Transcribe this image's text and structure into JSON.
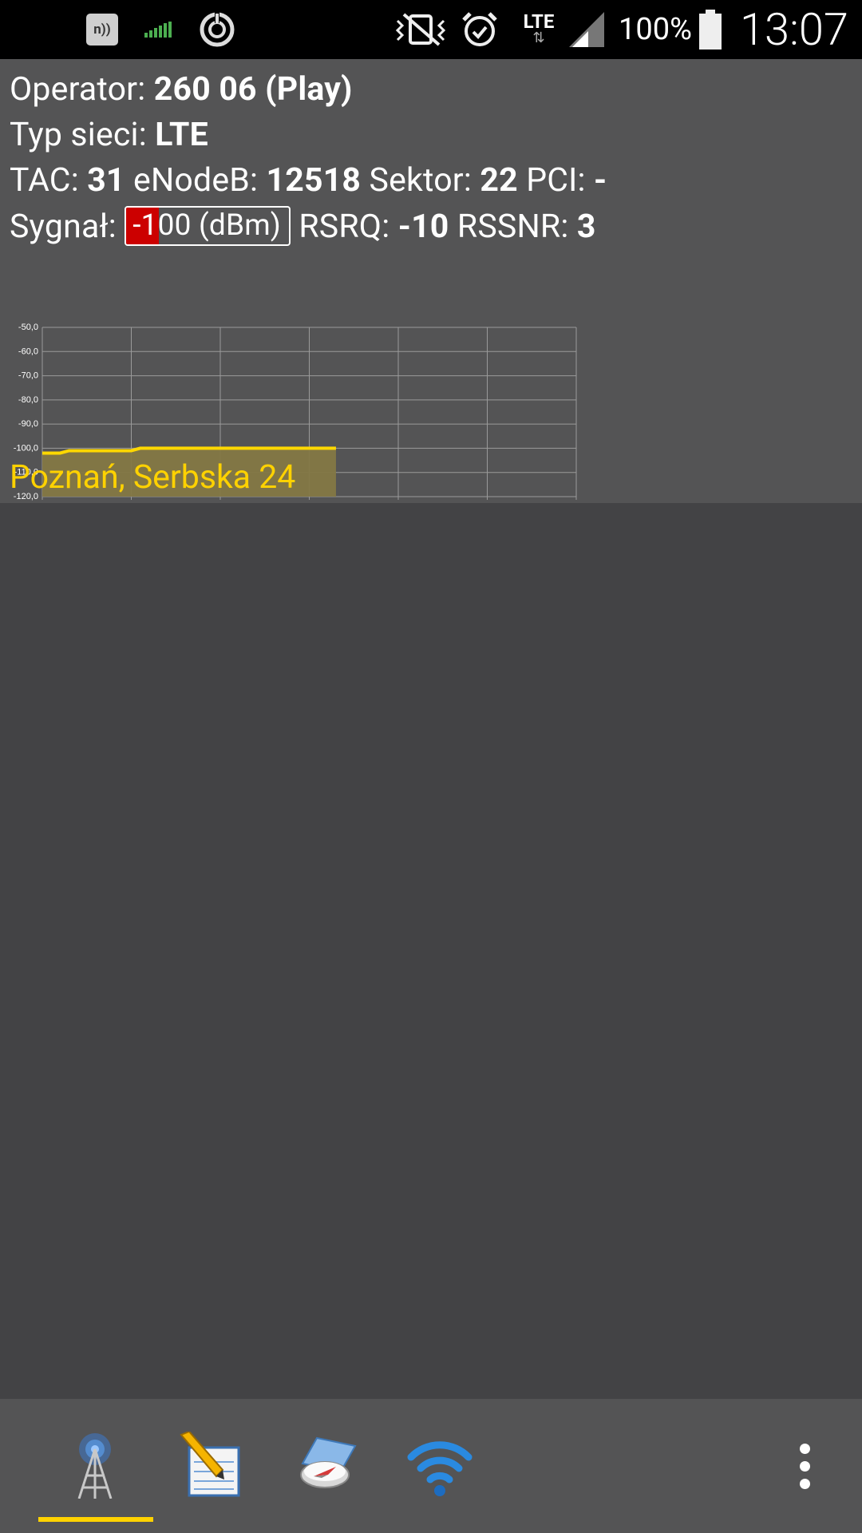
{
  "status_bar": {
    "nfc_label": "n))",
    "battery_text": "100%",
    "time": "13:07",
    "network_type": "LTE"
  },
  "info": {
    "operator_label": "Operator:",
    "operator_value": "260 06 (Play)",
    "network_type_label": "Typ sieci:",
    "network_type_value": "LTE",
    "tac_label": "TAC:",
    "tac_value": "31",
    "enodeb_label": "eNodeB:",
    "enodeb_value": "12518",
    "sector_label": "Sektor:",
    "sector_value": "22",
    "pci_label": "PCI:",
    "pci_value": "-",
    "signal_label": "Sygnał:",
    "signal_value": "-100 (dBm)",
    "signal_fill_fraction": 0.2,
    "rsrq_label": "RSRQ:",
    "rsrq_value": "-10",
    "rssnr_label": "RSSNR:",
    "rssnr_value": "3",
    "address": "Poznań, Serbska 24"
  },
  "chart_data": {
    "type": "area",
    "y_ticks": [
      "-50,0",
      "-60,0",
      "-70,0",
      "-80,0",
      "-90,0",
      "-100,0",
      "-110,0",
      "-120,0"
    ],
    "ylim": [
      -120,
      -50
    ],
    "x": [
      0,
      0.2,
      0.3,
      1,
      1.1,
      3.3
    ],
    "values": [
      -102,
      -102,
      -101,
      -101,
      -100,
      -100
    ],
    "x_divisions": 6,
    "grid": true,
    "line_color": "#ffd800",
    "fill_color": "#847845"
  },
  "bottom_tabs": [
    {
      "name": "cell-tower-icon",
      "selected": true
    },
    {
      "name": "notepad-icon",
      "selected": false
    },
    {
      "name": "compass-map-icon",
      "selected": false
    },
    {
      "name": "wifi-icon",
      "selected": false
    }
  ],
  "colors": {
    "accent": "#ffd200",
    "signal_bad": "#cc0000",
    "panel_bg": "#545455",
    "page_bg": "#434345"
  }
}
